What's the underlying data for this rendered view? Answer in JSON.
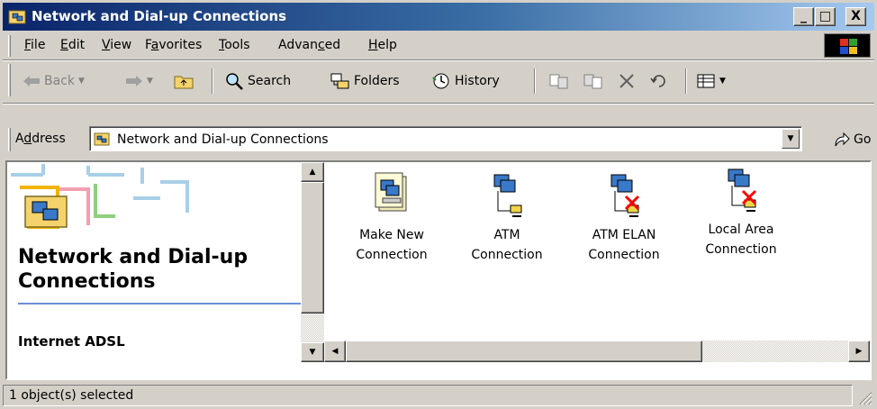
{
  "window": {
    "title": "Network and Dial-up Connections",
    "controls": {
      "minimize": "_",
      "maximize": "□",
      "close": "X"
    }
  },
  "menu": [
    {
      "key": "F",
      "rest": "ile"
    },
    {
      "key": "E",
      "rest": "dit"
    },
    {
      "key": "V",
      "rest": "iew"
    },
    {
      "pre": "F",
      "key": "a",
      "rest": "vorites"
    },
    {
      "key": "T",
      "rest": "ools"
    },
    {
      "pre": "Advan",
      "key": "c",
      "rest": "ed"
    },
    {
      "key": "H",
      "rest": "elp"
    }
  ],
  "toolbar": {
    "back": "Back",
    "search": "Search",
    "folders": "Folders",
    "history": "History"
  },
  "address": {
    "label_pre": "A",
    "label_key": "d",
    "label_rest": "dress",
    "value": "Network and Dial-up Connections",
    "go": "Go"
  },
  "left_panel": {
    "title": "Network and Dial-up Connections",
    "subtitle": "Internet ADSL"
  },
  "items": [
    {
      "line1": "Make New",
      "line2": "Connection"
    },
    {
      "line1": "ATM",
      "line2": "Connection"
    },
    {
      "line1": "ATM ELAN",
      "line2": "Connection"
    },
    {
      "line1": "Local Area",
      "line2": "Connection"
    }
  ],
  "status": {
    "text": "1 object(s) selected"
  },
  "colors": {
    "title_start": "#0a246a",
    "title_end": "#a6caf0",
    "face": "#d4d0c8",
    "rule": "#6b8fd6",
    "disconnect": "#ff0000"
  }
}
